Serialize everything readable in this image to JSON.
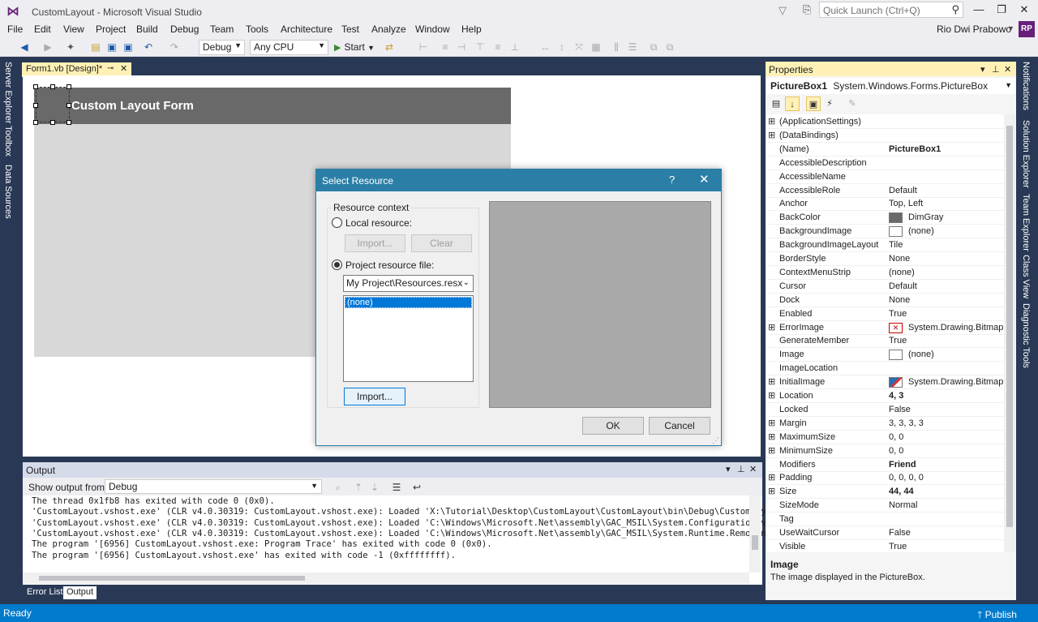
{
  "window": {
    "title": "CustomLayout - Microsoft Visual Studio",
    "quick_launch_placeholder": "Quick Launch (Ctrl+Q)",
    "user_name": "Rio Dwi Prabowo",
    "user_initials": "RP"
  },
  "menu": [
    "File",
    "Edit",
    "View",
    "Project",
    "Build",
    "Debug",
    "Team",
    "Tools",
    "Architecture",
    "Test",
    "Analyze",
    "Window",
    "Help"
  ],
  "toolbar": {
    "configuration": "Debug",
    "platform": "Any CPU",
    "start_label": "Start"
  },
  "left_tabs": [
    "Server Explorer",
    "Toolbox",
    "Data Sources"
  ],
  "right_tabs": [
    "Notifications",
    "Solution Explorer",
    "Team Explorer",
    "Class View",
    "Diagnostic Tools"
  ],
  "document_tab": "Form1.vb [Design]*",
  "form": {
    "header_title": "Custom Layout Form"
  },
  "output": {
    "title": "Output",
    "show_from_label": "Show output from:",
    "source": "Debug",
    "lines": [
      "The thread 0x1fb8 has exited with code 0 (0x0).",
      "'CustomLayout.vshost.exe' (CLR v4.0.30319: CustomLayout.vshost.exe): Loaded 'X:\\Tutorial\\Desktop\\CustomLayout\\CustomLayout\\bin\\Debug\\CustomLay",
      "'CustomLayout.vshost.exe' (CLR v4.0.30319: CustomLayout.vshost.exe): Loaded 'C:\\Windows\\Microsoft.Net\\assembly\\GAC_MSIL\\System.Configuration\\v",
      "'CustomLayout.vshost.exe' (CLR v4.0.30319: CustomLayout.vshost.exe): Loaded 'C:\\Windows\\Microsoft.Net\\assembly\\GAC_MSIL\\System.Runtime.Remotin",
      "The program '[6956] CustomLayout.vshost.exe: Program Trace' has exited with code 0 (0x0).",
      "The program '[6956] CustomLayout.vshost.exe' has exited with code -1 (0xffffffff)."
    ]
  },
  "bottom_tabs": [
    "Error List",
    "Output"
  ],
  "status": {
    "text": "Ready",
    "publish": "Publish"
  },
  "properties": {
    "title": "Properties",
    "object_name": "PictureBox1",
    "object_type": "System.Windows.Forms.PictureBox",
    "rows": [
      {
        "name": "(ApplicationSettings)",
        "value": "",
        "expandable": true
      },
      {
        "name": "(DataBindings)",
        "value": "",
        "expandable": true
      },
      {
        "name": "(Name)",
        "value": "PictureBox1",
        "bold": true
      },
      {
        "name": "AccessibleDescription",
        "value": ""
      },
      {
        "name": "AccessibleName",
        "value": ""
      },
      {
        "name": "AccessibleRole",
        "value": "Default"
      },
      {
        "name": "Anchor",
        "value": "Top, Left"
      },
      {
        "name": "BackColor",
        "value": "DimGray",
        "swatch": "#696969"
      },
      {
        "name": "BackgroundImage",
        "value": "(none)",
        "swatch": "#ffffff"
      },
      {
        "name": "BackgroundImageLayout",
        "value": "Tile"
      },
      {
        "name": "BorderStyle",
        "value": "None"
      },
      {
        "name": "ContextMenuStrip",
        "value": "(none)"
      },
      {
        "name": "Cursor",
        "value": "Default"
      },
      {
        "name": "Dock",
        "value": "None"
      },
      {
        "name": "Enabled",
        "value": "True"
      },
      {
        "name": "ErrorImage",
        "value": "System.Drawing.Bitmap",
        "expandable": true,
        "swatch": "error"
      },
      {
        "name": "GenerateMember",
        "value": "True"
      },
      {
        "name": "Image",
        "value": "(none)",
        "swatch": "#ffffff"
      },
      {
        "name": "ImageLocation",
        "value": ""
      },
      {
        "name": "InitialImage",
        "value": "System.Drawing.Bitmap",
        "expandable": true,
        "swatch": "image"
      },
      {
        "name": "Location",
        "value": "4, 3",
        "expandable": true,
        "bold": true
      },
      {
        "name": "Locked",
        "value": "False"
      },
      {
        "name": "Margin",
        "value": "3, 3, 3, 3",
        "expandable": true
      },
      {
        "name": "MaximumSize",
        "value": "0, 0",
        "expandable": true
      },
      {
        "name": "MinimumSize",
        "value": "0, 0",
        "expandable": true
      },
      {
        "name": "Modifiers",
        "value": "Friend",
        "bold": true
      },
      {
        "name": "Padding",
        "value": "0, 0, 0, 0",
        "expandable": true
      },
      {
        "name": "Size",
        "value": "44, 44",
        "expandable": true,
        "bold": true
      },
      {
        "name": "SizeMode",
        "value": "Normal"
      },
      {
        "name": "Tag",
        "value": ""
      },
      {
        "name": "UseWaitCursor",
        "value": "False"
      },
      {
        "name": "Visible",
        "value": "True"
      }
    ],
    "description_title": "Image",
    "description_text": "The image displayed in the PictureBox."
  },
  "dialog": {
    "title": "Select Resource",
    "help": "?",
    "resource_context_label": "Resource context",
    "local_resource_label": "Local resource:",
    "local_import_label": "Import...",
    "clear_label": "Clear",
    "project_resource_label": "Project resource file:",
    "resource_file": "My Project\\Resources.resx",
    "list_items": [
      "(none)"
    ],
    "import_label": "Import...",
    "ok_label": "OK",
    "cancel_label": "Cancel"
  }
}
